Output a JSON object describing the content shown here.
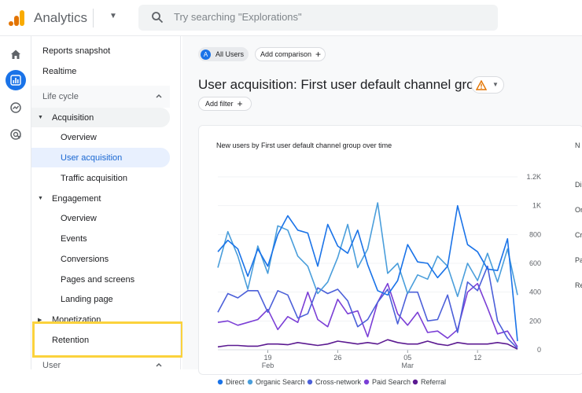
{
  "topbar": {
    "app_name": "Analytics",
    "search_placeholder": "Try searching \"Explorations\""
  },
  "rail": {
    "icons": [
      "home-icon",
      "reports-icon",
      "explore-icon",
      "advertising-icon"
    ],
    "active": "reports-icon"
  },
  "nav": {
    "reports_snapshot": "Reports snapshot",
    "realtime": "Realtime",
    "section_lifecycle": "Life cycle",
    "acquisition": "Acquisition",
    "acq_overview": "Overview",
    "user_acquisition": "User acquisition",
    "traffic_acquisition": "Traffic acquisition",
    "engagement": "Engagement",
    "eng_overview": "Overview",
    "events": "Events",
    "conversions": "Conversions",
    "pages_and_screens": "Pages and screens",
    "landing_page": "Landing page",
    "monetization": "Monetization",
    "retention": "Retention",
    "section_user": "User"
  },
  "main": {
    "all_users_badge": "A",
    "all_users": "All Users",
    "add_comparison": "Add comparison",
    "title": "User acquisition: First user default channel group",
    "add_filter": "Add filter"
  },
  "right_cut_labels": [
    "N",
    "Di",
    "Or",
    "Cr",
    "Pa",
    "Re"
  ],
  "colors": {
    "Direct": "#1a73e8",
    "Organic Search": "#4a9edb",
    "Cross-network": "#4c60d9",
    "Paid Search": "#7b3fd6",
    "Referral": "#5b1a91"
  },
  "chart_data": {
    "type": "line",
    "title": "New users by First user default channel group over time",
    "x_ticks": [
      {
        "day": "19",
        "month": "Feb"
      },
      {
        "day": "26",
        "month": ""
      },
      {
        "day": "05",
        "month": "Mar"
      },
      {
        "day": "12",
        "month": ""
      }
    ],
    "y_ticks": [
      "1.2K",
      "1K",
      "800",
      "600",
      "400",
      "200",
      "0"
    ],
    "ylim": [
      0,
      1200
    ],
    "y_axis_side": "right",
    "x_start_day": "Feb 14",
    "series": [
      {
        "name": "Direct",
        "values": [
          680,
          760,
          700,
          510,
          700,
          580,
          800,
          930,
          830,
          810,
          580,
          870,
          720,
          670,
          830,
          590,
          410,
          380,
          480,
          730,
          610,
          600,
          500,
          580,
          1000,
          730,
          680,
          560,
          550,
          770,
          60
        ]
      },
      {
        "name": "Organic Search",
        "values": [
          570,
          820,
          650,
          420,
          720,
          530,
          860,
          830,
          650,
          580,
          390,
          470,
          640,
          870,
          570,
          700,
          1020,
          530,
          600,
          390,
          520,
          490,
          650,
          580,
          370,
          600,
          480,
          670,
          470,
          700,
          380
        ]
      },
      {
        "name": "Cross-network",
        "values": [
          260,
          390,
          360,
          410,
          410,
          260,
          410,
          380,
          220,
          250,
          430,
          390,
          420,
          340,
          160,
          210,
          330,
          420,
          180,
          400,
          400,
          200,
          210,
          380,
          120,
          470,
          410,
          580,
          200,
          80,
          10
        ]
      },
      {
        "name": "Paid Search",
        "values": [
          190,
          200,
          170,
          190,
          210,
          280,
          140,
          230,
          190,
          400,
          210,
          160,
          350,
          250,
          270,
          90,
          330,
          460,
          250,
          170,
          260,
          120,
          130,
          80,
          140,
          400,
          460,
          290,
          110,
          130,
          20
        ]
      },
      {
        "name": "Referral",
        "values": [
          20,
          30,
          30,
          25,
          25,
          40,
          40,
          35,
          50,
          40,
          30,
          40,
          60,
          50,
          40,
          50,
          40,
          70,
          50,
          40,
          40,
          60,
          40,
          30,
          50,
          40,
          40,
          40,
          50,
          40,
          5
        ]
      }
    ]
  }
}
